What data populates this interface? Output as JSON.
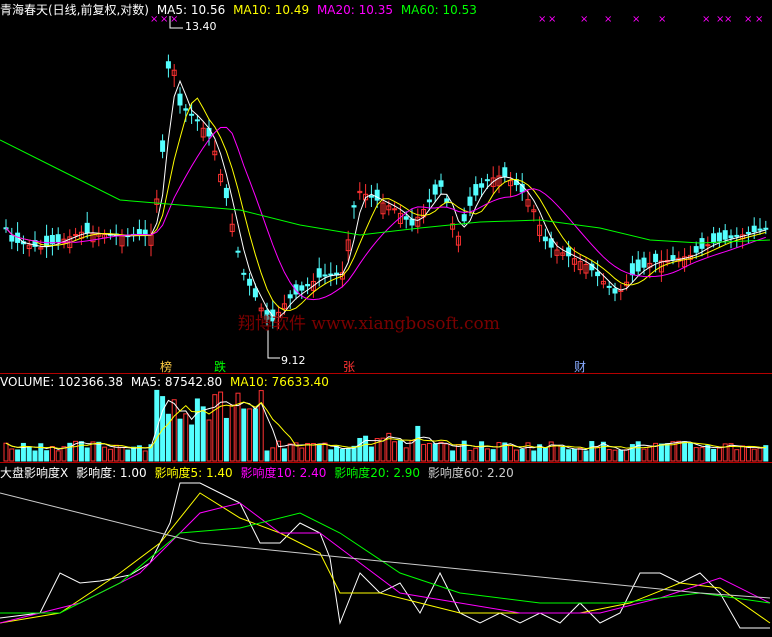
{
  "colors": {
    "background": "#000000",
    "up": "#ff3232",
    "down": "#54ffff",
    "ma5": "#ffffff",
    "ma10": "#ffff00",
    "ma20": "#ff00ff",
    "ma60": "#00ff00",
    "ma_long": "#cccccc",
    "separator": "#b40000"
  },
  "main": {
    "title": "青海春天(日线,前复权,对数)",
    "ma5": "MA5: 10.56",
    "ma10": "MA10: 10.49",
    "ma20": "MA20: 10.35",
    "ma60": "MA60: 10.53",
    "high_label": "13.40",
    "low_label": "9.12",
    "markers": {
      "bang": "榜",
      "die": "跌",
      "zhang": "张",
      "cai": "财"
    },
    "watermark": "翔博软件 www.xiangbosoft.com",
    "x_marks_count": 17
  },
  "volume": {
    "label": "VOLUME: 102366.38",
    "ma5": "MA5: 87542.80",
    "ma10": "MA10: 76633.40"
  },
  "indicator": {
    "title": "大盘影响度X",
    "v": "影响度: 1.00",
    "v5": "影响度5: 1.40",
    "v10": "影响度10: 2.40",
    "v20": "影响度20: 2.90",
    "v60": "影响度60: 2.20"
  }
}
